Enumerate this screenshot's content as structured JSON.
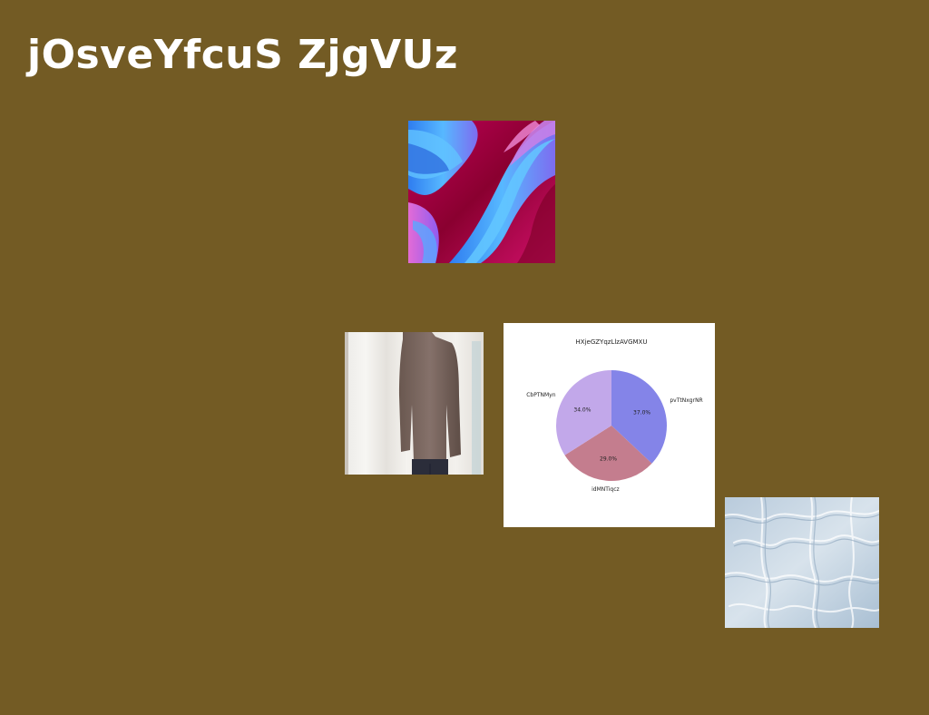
{
  "page": {
    "title": "jOsveYfcuS ZjgVUz",
    "background": "#735b24"
  },
  "images": [
    {
      "id": "waves",
      "description": "abstract image: blue, purple and pink wavy ribbons on magenta"
    },
    {
      "id": "person",
      "description": "photo of a person in a brown long-sleeve sweater standing by a white curtain"
    },
    {
      "id": "texture",
      "description": "light blue crumpled/cracked fabric texture"
    }
  ],
  "chart_data": {
    "type": "pie",
    "title": "HXjeGZYqzLlzAVGMXU",
    "labels": [
      "pvTtNxgrNR",
      "idMNTiqcz",
      "CbPTNMyn"
    ],
    "values": [
      37.0,
      29.0,
      34.0
    ],
    "percent_labels": [
      "37.0%",
      "29.0%",
      "34.0%"
    ],
    "colors": [
      "#8484e8",
      "#c47d8e",
      "#c2a8ea"
    ]
  }
}
